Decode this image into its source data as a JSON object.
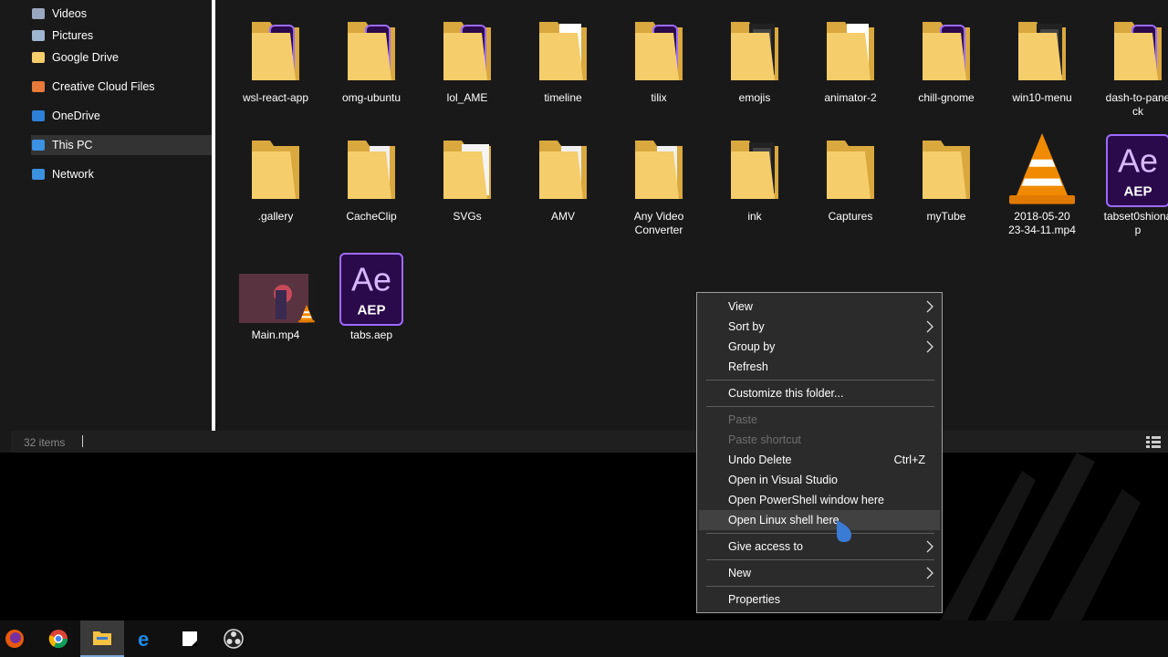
{
  "nav": {
    "items": [
      {
        "label": "Videos",
        "icon": "videos-folder-icon",
        "pinned": true
      },
      {
        "label": "Pictures",
        "icon": "pictures-folder-icon",
        "pinned": true
      },
      {
        "label": "Google Drive",
        "icon": "google-drive-folder-icon",
        "pinned": true
      },
      {
        "label": "Creative Cloud Files",
        "icon": "creative-cloud-icon",
        "pinned": false
      },
      {
        "label": "OneDrive",
        "icon": "onedrive-cloud-icon",
        "pinned": false
      },
      {
        "label": "This PC",
        "icon": "monitor-icon",
        "pinned": false,
        "selected": true
      },
      {
        "label": "Network",
        "icon": "network-icon",
        "pinned": false
      }
    ]
  },
  "files": {
    "row1": [
      {
        "name": "wsl-react-app",
        "icon": "folder-ae-icon"
      },
      {
        "name": "omg-ubuntu",
        "icon": "folder-ae-icon"
      },
      {
        "name": "lol_AME",
        "icon": "folder-ae-icon"
      },
      {
        "name": "timeline",
        "icon": "folder-vlc-icon"
      },
      {
        "name": "tilix",
        "icon": "folder-ae-icon"
      },
      {
        "name": "emojis",
        "icon": "folder-image-icon"
      },
      {
        "name": "animator-2",
        "icon": "folder-vlc-icon"
      },
      {
        "name": "chill-gnome",
        "icon": "folder-ae-icon"
      },
      {
        "name": "win10-menu",
        "icon": "folder-image-icon"
      },
      {
        "name": "dash-to-pane\nck",
        "icon": "folder-ae-icon"
      }
    ],
    "row2": [
      {
        "name": ".gallery",
        "icon": "folder-icon"
      },
      {
        "name": "CacheClip",
        "icon": "folder-doc-icon"
      },
      {
        "name": "SVGs",
        "icon": "folder-svg-icon"
      },
      {
        "name": "AMV",
        "icon": "folder-doc-icon"
      },
      {
        "name": "Any Video\nConverter",
        "icon": "folder-doc-icon"
      },
      {
        "name": "ink",
        "icon": "folder-image-icon"
      },
      {
        "name": "Captures",
        "icon": "folder-icon"
      },
      {
        "name": "myTube",
        "icon": "folder-icon"
      },
      {
        "name": "2018-05-20\n23-34-11.mp4",
        "icon": "vlc-cone-icon"
      },
      {
        "name": "tabset0shiona\np",
        "icon": "ae-file-icon"
      }
    ],
    "row3": [
      {
        "name": "Main.mp4",
        "icon": "video-thumbnail-icon"
      },
      {
        "name": "tabs.aep",
        "icon": "ae-file-icon"
      }
    ],
    "ae_text": "Ae",
    "aep_text": "AEP"
  },
  "status": {
    "count": "32 items"
  },
  "context_menu": {
    "items": [
      {
        "label": "View",
        "type": "submenu"
      },
      {
        "label": "Sort by",
        "type": "submenu"
      },
      {
        "label": "Group by",
        "type": "submenu"
      },
      {
        "label": "Refresh",
        "type": "item"
      },
      {
        "type": "separator"
      },
      {
        "label": "Customize this folder...",
        "type": "item"
      },
      {
        "type": "separator"
      },
      {
        "label": "Paste",
        "type": "disabled"
      },
      {
        "label": "Paste shortcut",
        "type": "disabled"
      },
      {
        "label": "Undo Delete",
        "type": "item",
        "shortcut": "Ctrl+Z"
      },
      {
        "label": "Open in Visual Studio",
        "type": "item"
      },
      {
        "label": "Open PowerShell window here",
        "type": "item"
      },
      {
        "label": "Open Linux shell here",
        "type": "item",
        "hover": true
      },
      {
        "type": "separator"
      },
      {
        "label": "Give access to",
        "type": "submenu"
      },
      {
        "type": "separator"
      },
      {
        "label": "New",
        "type": "submenu"
      },
      {
        "type": "separator"
      },
      {
        "label": "Properties",
        "type": "item"
      }
    ]
  },
  "taskbar": {
    "icons": [
      "firefox-icon",
      "chrome-icon",
      "file-explorer-icon",
      "edge-icon",
      "sticky-notes-icon",
      "obs-icon"
    ],
    "active_index": 2
  },
  "colors": {
    "folder": "#f5cd6b",
    "ae_purple": "#2a0a4a",
    "ae_border": "#9d6bff",
    "vlc_orange": "#f08a00",
    "accent": "#3a7bd5"
  }
}
